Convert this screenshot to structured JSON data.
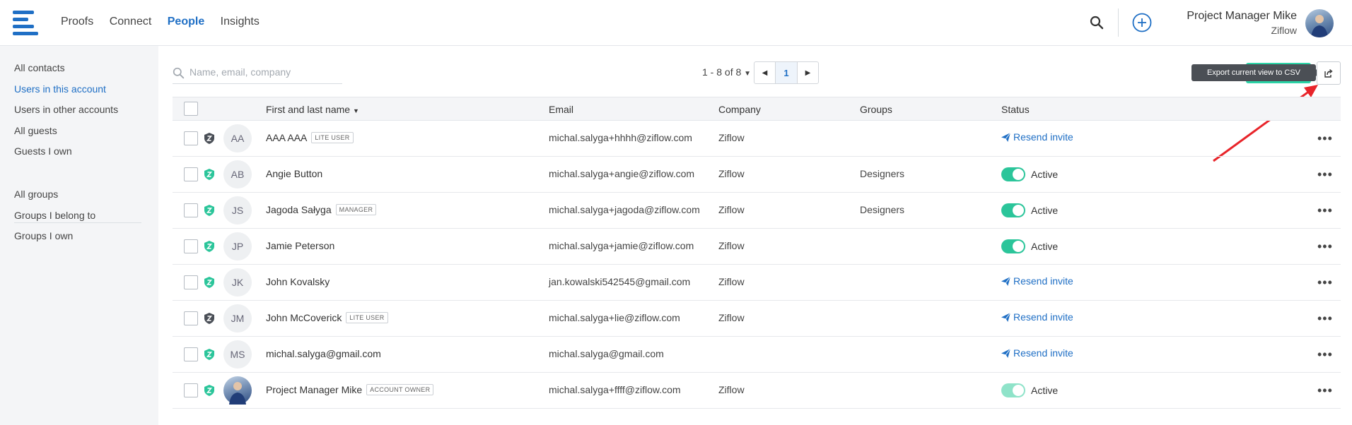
{
  "nav": {
    "items": [
      "Proofs",
      "Connect",
      "People",
      "Insights"
    ],
    "active": "People"
  },
  "user": {
    "name": "Project Manager Mike",
    "org": "Ziflow"
  },
  "sidebar": {
    "contacts": [
      "All contacts",
      "Users in this account",
      "Users in other accounts",
      "All guests",
      "Guests I own"
    ],
    "groups": [
      "All groups",
      "Groups I belong to",
      "Groups I own"
    ],
    "active": "Users in this account"
  },
  "search": {
    "placeholder": "Name, email, company",
    "value": ""
  },
  "pagination": {
    "info": "1 - 8 of 8",
    "page": "1"
  },
  "export": {
    "tooltip": "Export current view to CSV"
  },
  "table": {
    "headers": {
      "name": "First and last name",
      "email": "Email",
      "company": "Company",
      "groups": "Groups",
      "status": "Status"
    },
    "rows": [
      {
        "initials": "AA",
        "name": "AAA AAA",
        "badge": "LITE USER",
        "email": "michal.salyga+hhhh@ziflow.com",
        "company": "Ziflow",
        "groups": "",
        "status": "Resend invite",
        "shield": "dark"
      },
      {
        "initials": "AB",
        "name": "Angie Button",
        "badge": "",
        "email": "michal.salyga+angie@ziflow.com",
        "company": "Ziflow",
        "groups": "Designers",
        "status": "Active",
        "shield": "green"
      },
      {
        "initials": "JS",
        "name": "Jagoda Sałyga",
        "badge": "MANAGER",
        "email": "michal.salyga+jagoda@ziflow.com",
        "company": "Ziflow",
        "groups": "Designers",
        "status": "Active",
        "shield": "green"
      },
      {
        "initials": "JP",
        "name": "Jamie Peterson",
        "badge": "",
        "email": "michal.salyga+jamie@ziflow.com",
        "company": "Ziflow",
        "groups": "",
        "status": "Active",
        "shield": "green"
      },
      {
        "initials": "JK",
        "name": "John Kovalsky",
        "badge": "",
        "email": "jan.kowalski542545@gmail.com",
        "company": "Ziflow",
        "groups": "",
        "status": "Resend invite",
        "shield": "green"
      },
      {
        "initials": "JM",
        "name": "John McCoverick",
        "badge": "LITE USER",
        "email": "michal.salyga+lie@ziflow.com",
        "company": "Ziflow",
        "groups": "",
        "status": "Resend invite",
        "shield": "dark"
      },
      {
        "initials": "MS",
        "name": "michal.salyga@gmail.com",
        "badge": "",
        "email": "michal.salyga@gmail.com",
        "company": "",
        "groups": "",
        "status": "Resend invite",
        "shield": "green"
      },
      {
        "initials": "",
        "name": "Project Manager Mike",
        "badge": "ACCOUNT OWNER",
        "email": "michal.salyga+ffff@ziflow.com",
        "company": "Ziflow",
        "groups": "",
        "status": "Active",
        "shield": "green",
        "photo": true,
        "toggle_dim": true
      }
    ]
  },
  "colors": {
    "accent": "#1f6fc5",
    "green": "#2bc59a",
    "sidebar_bg": "#f4f5f7",
    "annotation_arrow": "#e8242a"
  }
}
